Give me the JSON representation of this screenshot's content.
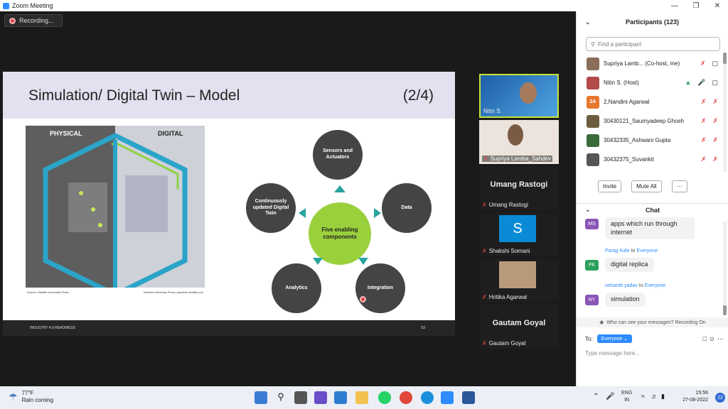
{
  "window": {
    "title": "Zoom Meeting"
  },
  "recording": {
    "label": "Recording..."
  },
  "slide": {
    "title": "Simulation/ Digital Twin – Model",
    "page": "(2/4)",
    "footer_left": "INDUSTRY 4.0 READINESS",
    "footer_right": "53",
    "physical_label": "PHYSICAL",
    "digital_label": "DIGITAL",
    "source_left": "Source: Deloitte University Press.",
    "source_right": "Deloitte University Press | dupress.deloitte.com",
    "center_label": "Five enabling components",
    "components": [
      "Sensors and Actuators",
      "Data",
      "Integration",
      "Analytics",
      "Continuously updated Digital Twin"
    ]
  },
  "videos": [
    {
      "name": "Nitin S."
    },
    {
      "name": "Supriya Lamba_Sahdev"
    },
    {
      "name": "Umang Rastogi",
      "display": "Umang Rastogi"
    },
    {
      "name": "Shakshi Somani",
      "avatar": "S"
    },
    {
      "name": "Hritika Agarwal"
    },
    {
      "name": "Gautam Goyal",
      "display": "Gautam Goyal"
    }
  ],
  "participants": {
    "title": "Participants (123)",
    "search_placeholder": "Find a participant",
    "items": [
      {
        "name": "Supriya Lamb...",
        "role": "(Co-host, me)",
        "avatar": "",
        "color": "#8a6d5a"
      },
      {
        "name": "Nitin S.",
        "role": "(Host)",
        "avatar": "",
        "color": "#b34a4a"
      },
      {
        "name": "2,Nandini Agarwal",
        "role": "",
        "avatar": "2A",
        "color": "#e8762d"
      },
      {
        "name": "30430121_Saumyadeep Ghosh",
        "role": "",
        "avatar": "",
        "color": "#6b5d3e"
      },
      {
        "name": "30432335_Ashwani Gupta",
        "role": "",
        "avatar": "",
        "color": "#3a6b3a"
      },
      {
        "name": "30432375_Suvankit",
        "role": "",
        "avatar": "",
        "color": "#555"
      }
    ],
    "invite": "Invite",
    "mute_all": "Mute All",
    "more": "···"
  },
  "chat": {
    "title": "Chat",
    "messages": [
      {
        "avatar": "MS",
        "color": "#8a55b5",
        "sender": "",
        "to": "",
        "text": "apps which run through internet"
      },
      {
        "avatar": "PK",
        "color": "#2aa05a",
        "sender": "Parag Kale",
        "to": "Everyone",
        "text": "digital replica"
      },
      {
        "avatar": "NY",
        "color": "#8a55b5",
        "sender": "nehanth yadav",
        "to": "Everyone",
        "text": "simulation"
      }
    ],
    "to_word": "to",
    "notice": "Who can see your messages? Recording On",
    "to_label": "To:",
    "recipient": "Everyone",
    "placeholder": "Type message here..."
  },
  "taskbar": {
    "temp": "77°F",
    "weather": "Rain coming",
    "lang1": "ENG",
    "lang2": "IN",
    "time": "15:56",
    "date": "27-08-2022",
    "badge": "22"
  }
}
